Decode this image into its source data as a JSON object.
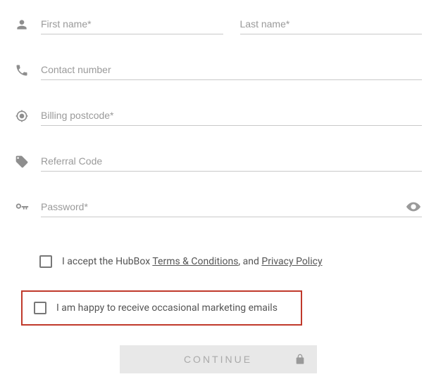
{
  "fields": {
    "first_name": {
      "placeholder": "First name*"
    },
    "last_name": {
      "placeholder": "Last name*"
    },
    "contact_number": {
      "placeholder": "Contact number"
    },
    "billing_postcode": {
      "placeholder": "Billing postcode*"
    },
    "referral_code": {
      "placeholder": "Referral Code"
    },
    "password": {
      "placeholder": "Password*"
    }
  },
  "checks": {
    "terms_prefix": "I accept the HubBox ",
    "terms_link1": "Terms & Conditions",
    "terms_mid": ", and ",
    "terms_link2": "Privacy Policy",
    "marketing_label": "I am happy to receive occasional marketing emails"
  },
  "continue_label": "CONTINUE"
}
